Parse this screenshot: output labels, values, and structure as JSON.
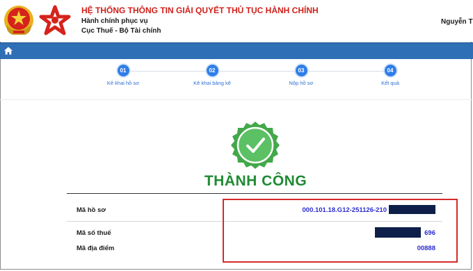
{
  "header": {
    "title": "HỆ THỐNG THÔNG TIN GIẢI QUYẾT THỦ TỤC HÀNH CHÍNH",
    "subtitle_1": "Hành chính phục vụ",
    "subtitle_2": "Cục Thuế - Bộ Tài chính",
    "user_name": "Nguyễn Th"
  },
  "nav": {
    "home_icon": "home-icon"
  },
  "steps": [
    {
      "number": "01",
      "label": "Kê khai hồ sơ"
    },
    {
      "number": "02",
      "label": "Kê khai bảng kê"
    },
    {
      "number": "03",
      "label": "Nộp hồ sơ"
    },
    {
      "number": "04",
      "label": "Kết quả"
    }
  ],
  "result": {
    "status": "THÀNH CÔNG",
    "badge_icon": "check-badge-icon"
  },
  "info": {
    "ma_ho_so": {
      "label": "Mã hồ sơ",
      "value": "000.101.18.G12-251126-210"
    },
    "ma_so_thue": {
      "label": "Mã số thuế",
      "value": "696"
    },
    "ma_dia_diem": {
      "label": "Mã địa điểm",
      "value": "00888"
    }
  },
  "colors": {
    "brand_red": "#d0201b",
    "nav_blue": "#2f6fb5",
    "step_blue": "#2f7ee8",
    "success_green": "#1f8a33",
    "value_blue": "#2c2ccf",
    "highlight_red": "#d42a2a"
  }
}
